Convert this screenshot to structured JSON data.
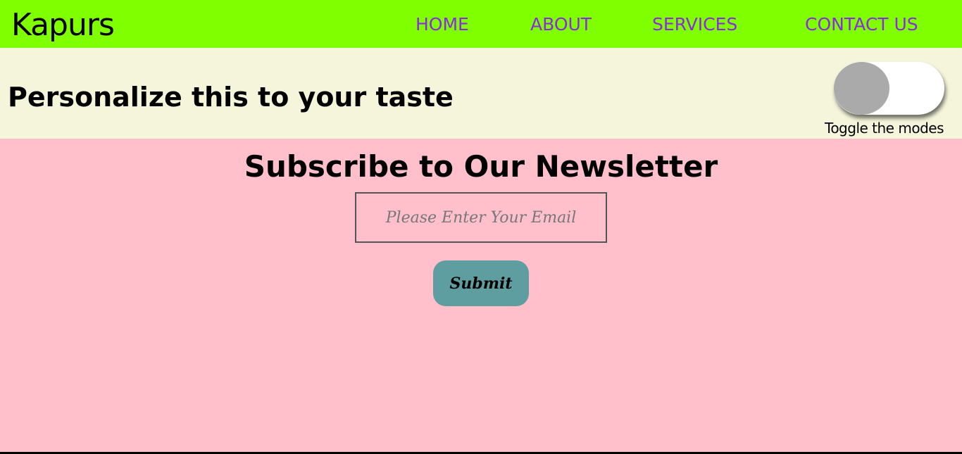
{
  "navbar": {
    "brand": "Kapurs",
    "links": [
      {
        "label": "HOME"
      },
      {
        "label": "ABOUT"
      },
      {
        "label": "SERVICES"
      },
      {
        "label": "CONTACT US"
      }
    ]
  },
  "personalize": {
    "title": "Personalize this to your taste",
    "toggle_caption": "Toggle the modes"
  },
  "newsletter": {
    "title": "Subscribe to Our Newsletter",
    "email_value": "",
    "email_placeholder": "Please Enter Your Email",
    "submit_label": "Submit"
  },
  "colors": {
    "navbar_bg": "#7fff00",
    "nav_link": "#8a2be2",
    "personalize_bg": "#f5f5dc",
    "page_bg": "#ffc0cb",
    "submit_bg": "#5f9ea0",
    "toggle_knob": "#aaaaaa"
  }
}
